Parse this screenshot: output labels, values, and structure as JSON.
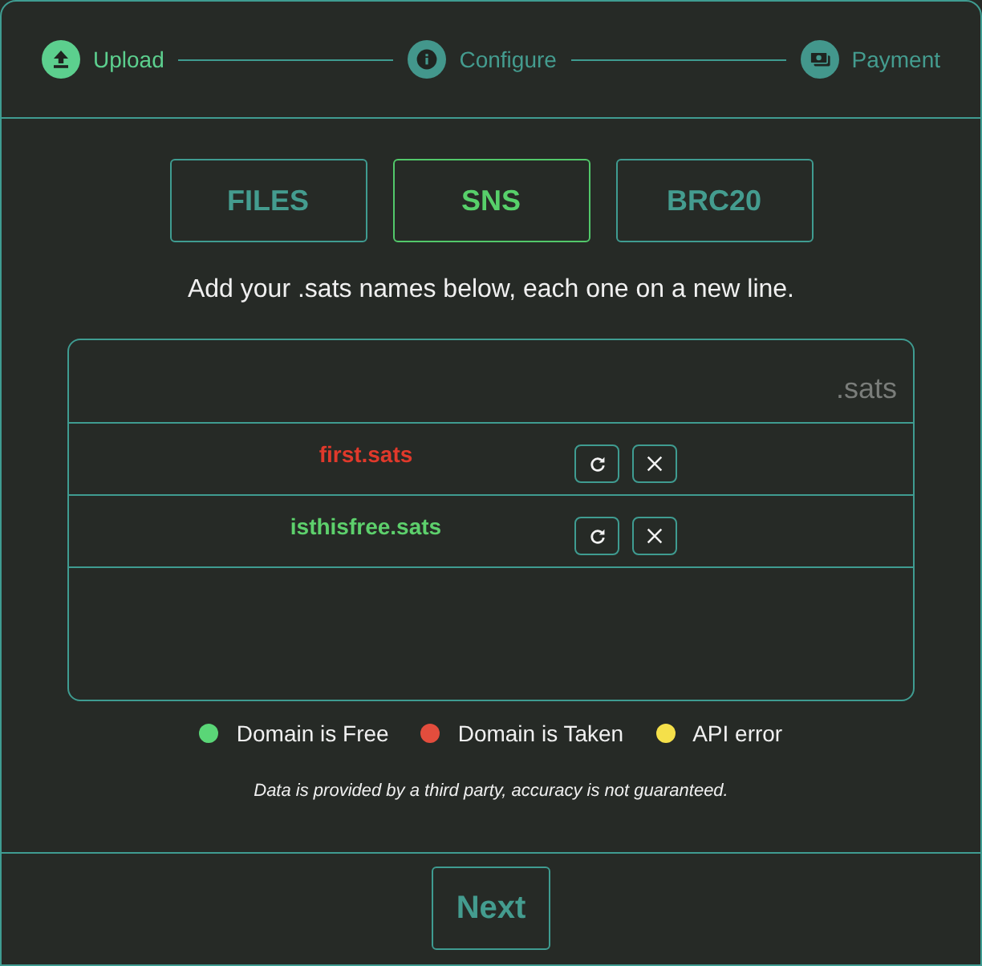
{
  "steps": [
    {
      "label": "Upload",
      "selected": true
    },
    {
      "label": "Configure",
      "selected": false
    },
    {
      "label": "Payment",
      "selected": false
    }
  ],
  "tabs": [
    {
      "label": "FILES",
      "selected": false
    },
    {
      "label": "SNS",
      "selected": true
    },
    {
      "label": "BRC20",
      "selected": false
    }
  ],
  "instruction": "Add your .sats names below, each one on a new line.",
  "name_input": {
    "suffix": ".sats"
  },
  "names": [
    {
      "name": "first.sats",
      "color": "#e0392b"
    },
    {
      "name": "isthisfree.sats",
      "color": "#5dd06c"
    }
  ],
  "legend": [
    {
      "label": "Domain is Free",
      "color": "#5ad677"
    },
    {
      "label": "Domain is Taken",
      "color": "#e34d3d"
    },
    {
      "label": "API error",
      "color": "#f5e04a"
    }
  ],
  "disclaimer": "Data is provided by a third party, accuracy is not guaranteed.",
  "next_button": {
    "label": "Next"
  }
}
